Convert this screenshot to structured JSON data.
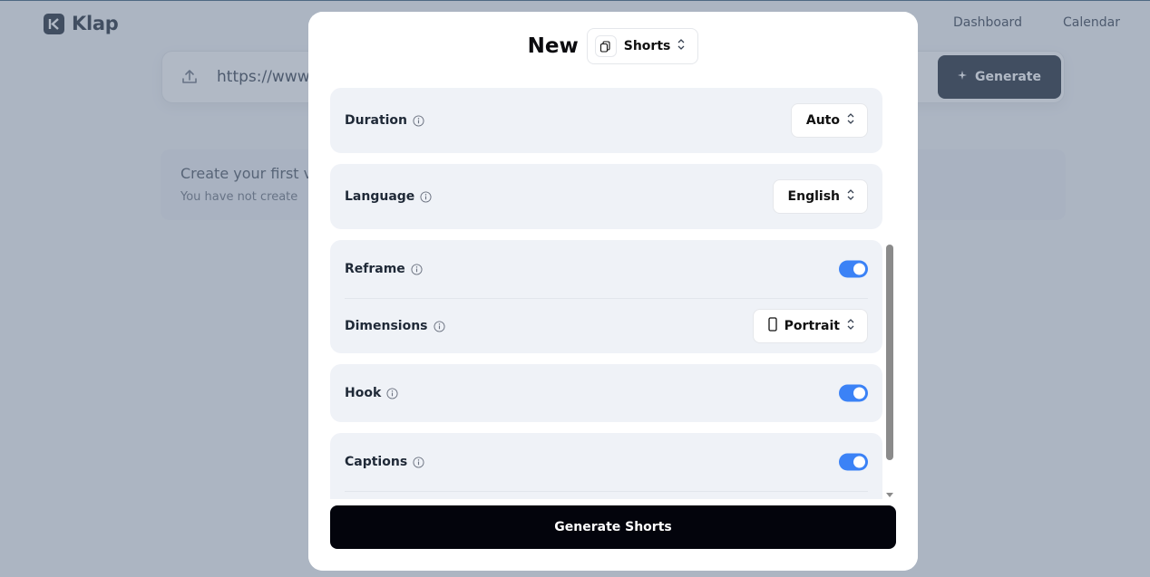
{
  "app": {
    "brand": "Klap",
    "nav": {
      "dashboard": "Dashboard",
      "calendar": "Calendar"
    }
  },
  "url_input": {
    "value": "https://www.",
    "generate_label": "Generate"
  },
  "empty_state": {
    "title": "Create your first v",
    "subtitle": "You have not create"
  },
  "modal": {
    "title": "New",
    "type_select": "Shorts",
    "settings": {
      "duration": {
        "label": "Duration",
        "value": "Auto"
      },
      "language": {
        "label": "Language",
        "value": "English"
      },
      "reframe": {
        "label": "Reframe",
        "enabled": true
      },
      "dimensions": {
        "label": "Dimensions",
        "value": "Portrait"
      },
      "hook": {
        "label": "Hook",
        "enabled": true
      },
      "captions": {
        "label": "Captions",
        "enabled": true
      }
    },
    "primary_button": "Generate Shorts"
  },
  "colors": {
    "accent": "#3b82f6",
    "primary_button": "#03040c",
    "section_bg": "#eff2f7"
  }
}
